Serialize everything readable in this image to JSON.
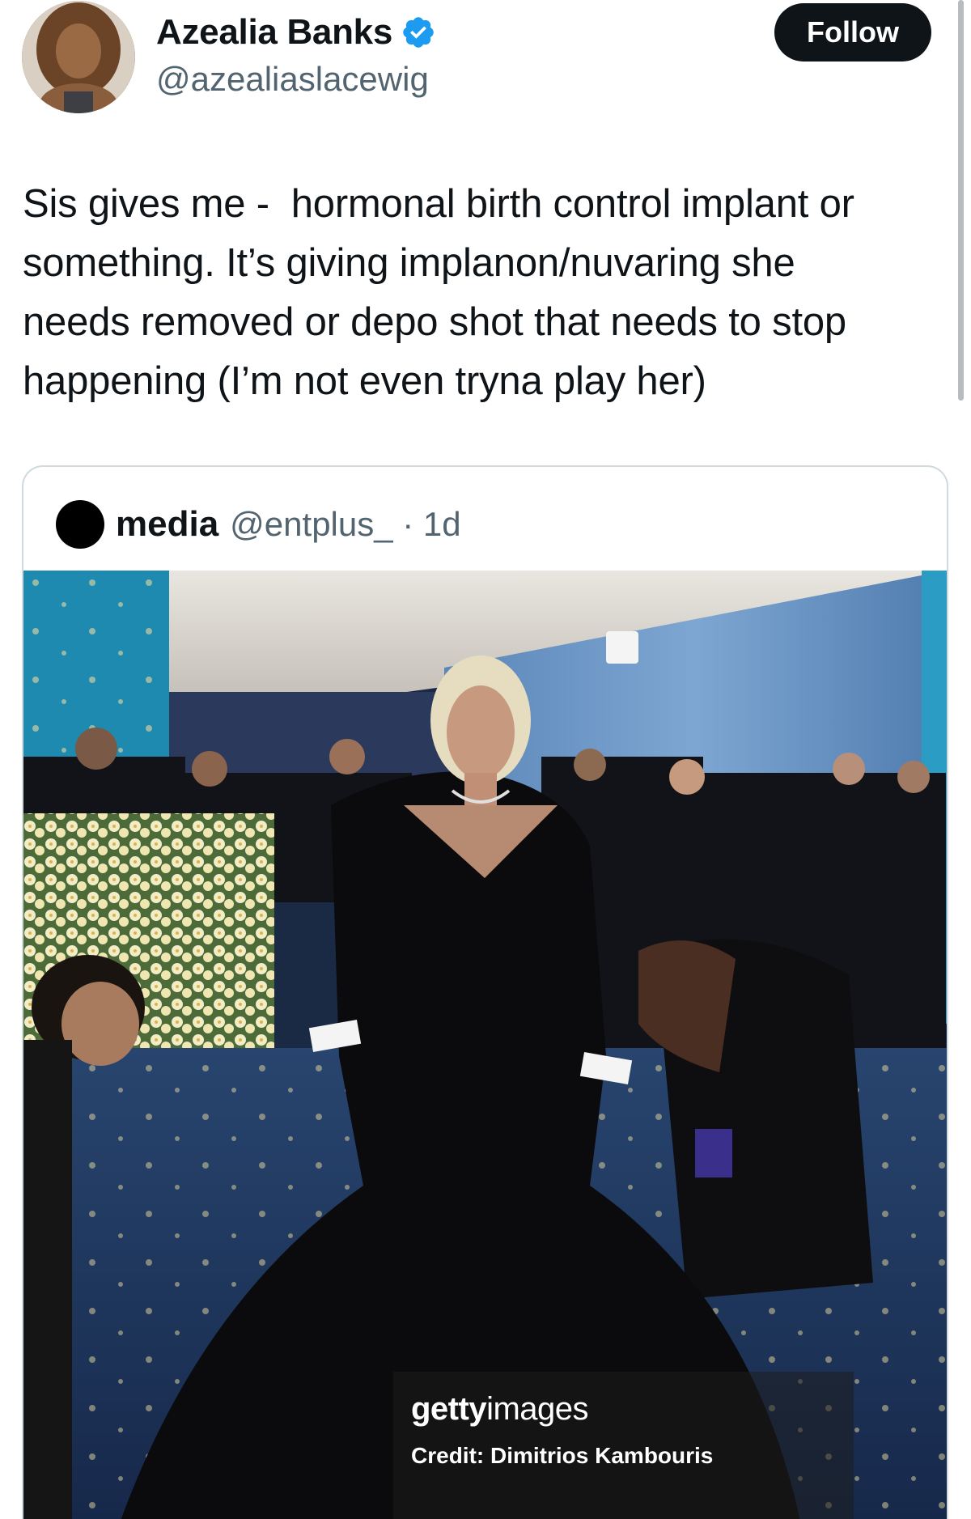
{
  "tweet": {
    "author": {
      "name": "Azealia Banks",
      "handle": "@azealiaslacewig",
      "verified": true
    },
    "follow_label": "Follow",
    "text": "Sis gives me -  hormonal birth control implant or\nsomething. It’s giving implanon/nuvaring she\nneeds removed or depo shot that needs to stop\nhappening (I’m not even tryna play her)"
  },
  "quoted_tweet": {
    "name": "media",
    "meta": "@entplus_ · 1d",
    "photo": {
      "watermark_brand": "getty",
      "watermark_suffix": "images",
      "credit": "Credit: Dimitrios Kambouris"
    }
  },
  "colors": {
    "text_primary": "#0f1419",
    "text_secondary": "#536471",
    "verified_blue": "#1d9bf0",
    "follow_button_bg": "#0f1419",
    "card_border": "#cfd9de"
  },
  "icons": {
    "verified": "verified-badge-icon"
  }
}
